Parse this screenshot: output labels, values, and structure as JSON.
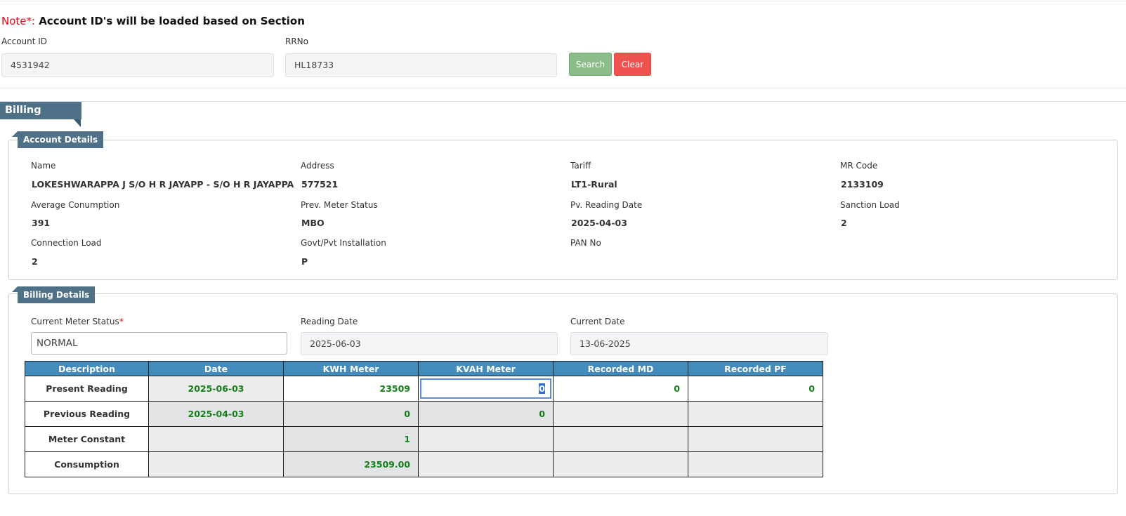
{
  "note": {
    "prefix": "Note*:",
    "text": "Account ID's will be loaded based on Section"
  },
  "search": {
    "account_id_label": "Account ID",
    "account_id_value": "4531942",
    "rrno_label": "RRNo",
    "rrno_value": "HL18733",
    "search_button": "Search",
    "clear_button": "Clear"
  },
  "section_title": "Billing Details",
  "account_details": {
    "title": "Account Details",
    "fields": [
      {
        "label": "Name",
        "value": "LOKESHWARAPPA J S/O H R JAYAPP - S/O H R JAYAPPA"
      },
      {
        "label": "Address",
        "value": "577521"
      },
      {
        "label": "Tariff",
        "value": "LT1-Rural"
      },
      {
        "label": "MR Code",
        "value": "2133109"
      },
      {
        "label": "Average Conumption",
        "value": "391"
      },
      {
        "label": "Prev. Meter Status",
        "value": "MBO"
      },
      {
        "label": "Pv. Reading Date",
        "value": "2025-04-03"
      },
      {
        "label": "Sanction Load",
        "value": "2"
      },
      {
        "label": "Connection Load",
        "value": "2"
      },
      {
        "label": "Govt/Pvt Installation",
        "value": "P"
      },
      {
        "label": "PAN No",
        "value": ""
      }
    ]
  },
  "billing_details": {
    "title": "Billing Details",
    "meter_status_label": "Current Meter Status",
    "meter_status_required": "*",
    "meter_status_value": "NORMAL",
    "reading_date_label": "Reading Date",
    "reading_date_value": "2025-06-03",
    "current_date_label": "Current Date",
    "current_date_value": "13-06-2025"
  },
  "readings_table": {
    "headers": [
      "Description",
      "Date",
      "KWH Meter",
      "KVAH Meter",
      "Recorded MD",
      "Recorded PF"
    ],
    "rows": [
      {
        "description": "Present Reading",
        "date": "2025-06-03",
        "kwh": "23509",
        "kvah": "0",
        "md": "0",
        "pf": "0"
      },
      {
        "description": "Previous Reading",
        "date": "2025-04-03",
        "kwh": "0",
        "kvah": "0"
      },
      {
        "description": "Meter Constant",
        "kwh": "1"
      },
      {
        "description": "Consumption",
        "kwh": "23509.00"
      }
    ]
  },
  "colors": {
    "header_blue": "#428bba",
    "tag_slate": "#4f7187",
    "value_green": "#15801a",
    "required_red": "#e4061a",
    "search_green": "#8bbd8a",
    "clear_red": "#ef5350"
  }
}
